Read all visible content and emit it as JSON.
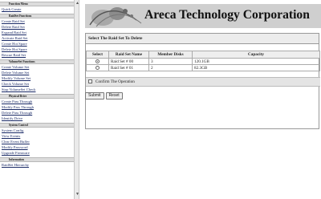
{
  "sidebar": {
    "sections": [
      {
        "title": "Function Menu",
        "items": [
          "Quick Create"
        ]
      },
      {
        "title": "RaidSet Functions",
        "items": [
          "Create Raid Set",
          "Delete Raid Set",
          "Expand Raid Set",
          "Activate Raid Set",
          "Create Hot Spare",
          "Delete Hot Spare",
          "Rescue Raid Set"
        ]
      },
      {
        "title": "VolumeSet Functions",
        "items": [
          "Create Volume Set",
          "Delete Volume Set",
          "Modify Volume Set",
          "Check Volume Set",
          "Stop VolumeSet Check"
        ]
      },
      {
        "title": "Physical Drive",
        "items": [
          "Create Pass Through",
          "Modify Pass Through",
          "Delete Pass Through",
          "Identify Drive"
        ]
      },
      {
        "title": "System Control",
        "items": [
          "System Config",
          "View Events",
          "Clear Event Buffer",
          "Modify Password",
          "Upgrade Firmware"
        ]
      },
      {
        "title": "Information",
        "items": [
          "RaidSet Hierarchy"
        ]
      }
    ]
  },
  "banner": {
    "brand": "Areca Technology Corporation"
  },
  "panel": {
    "title": "Select The Raid Set To Delete",
    "columns": [
      "Select",
      "Raid Set Name",
      "Member Disks",
      "Capacity"
    ],
    "rows": [
      {
        "selected": true,
        "name": "Raid Set # 00",
        "members": "3",
        "capacity": "120.1GB"
      },
      {
        "selected": false,
        "name": "Raid Set # 01",
        "members": "2",
        "capacity": "82.3GB"
      }
    ],
    "confirm_label": "Confirm The Operation"
  },
  "buttons": {
    "submit": "Submit",
    "reset": "Reset"
  }
}
